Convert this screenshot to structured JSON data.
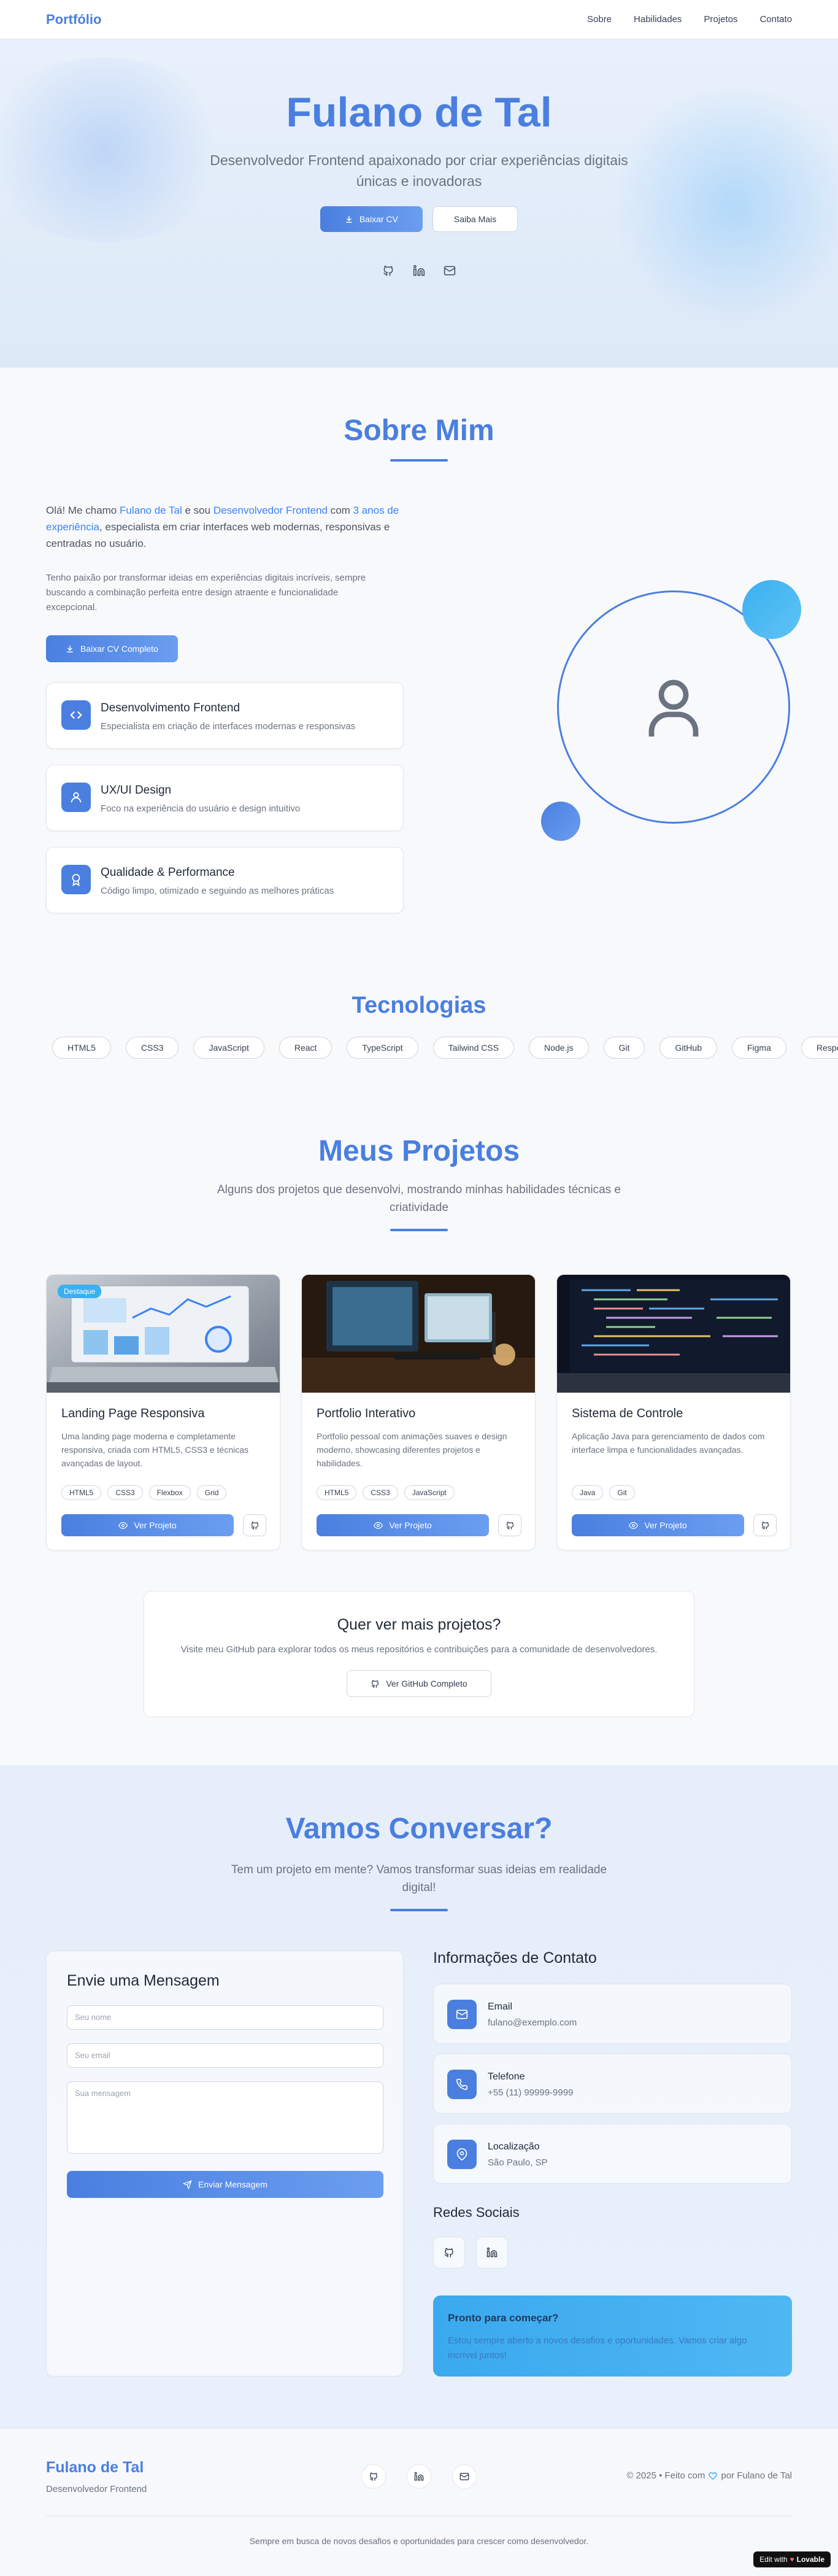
{
  "nav": {
    "brand": "Portfólio",
    "links": [
      "Sobre",
      "Habilidades",
      "Projetos",
      "Contato"
    ]
  },
  "hero": {
    "title": "Fulano de Tal",
    "subtitle": "Desenvolvedor Frontend apaixonado por criar experiências digitais únicas e inovadoras",
    "primary_button": "Baixar CV",
    "secondary_button": "Saiba Mais",
    "social_icons": [
      "github-icon",
      "linkedin-icon",
      "mail-icon"
    ]
  },
  "about": {
    "title": "Sobre Mim",
    "intro_prefix": "Olá! Me chamo ",
    "intro_name": "Fulano de Tal",
    "intro_mid": " e sou ",
    "intro_role": "Desenvolvedor Frontend",
    "intro_with": " com ",
    "intro_years": "3 anos de experiência",
    "intro_suffix": ", especialista em criar interfaces web modernas, responsivas e centradas no usuário.",
    "paragraph2": "Tenho paixão por transformar ideias em experiências digitais incríveis, sempre buscando a combinação perfeita entre design atraente e funcionalidade excepcional.",
    "cv_button": "Baixar CV Completo",
    "features": [
      {
        "icon": "code-icon",
        "title": "Desenvolvimento Frontend",
        "desc": "Especialista em criação de interfaces modernas e responsivas"
      },
      {
        "icon": "user-icon",
        "title": "UX/UI Design",
        "desc": "Foco na experiência do usuário e design intuitivo"
      },
      {
        "icon": "award-icon",
        "title": "Qualidade & Performance",
        "desc": "Código limpo, otimizado e seguindo as melhores práticas"
      }
    ],
    "avatar_icon": "user-icon"
  },
  "tech": {
    "title": "Tecnologias",
    "items": [
      "HTML5",
      "CSS3",
      "JavaScript",
      "React",
      "TypeScript",
      "Tailwind CSS",
      "Node.js",
      "Git",
      "GitHub",
      "Figma",
      "Responsive Design"
    ]
  },
  "projects": {
    "title": "Meus Projetos",
    "subtitle": "Alguns dos projetos que desenvolvi, mostrando minhas habilidades técnicas e criatividade",
    "view_label": "Ver Projeto",
    "items": [
      {
        "badge": "Destaque",
        "title": "Landing Page Responsiva",
        "desc": "Uma landing page moderna e completamente responsiva, criada com HTML5, CSS3 e técnicas avançadas de layout.",
        "tags": [
          "HTML5",
          "CSS3",
          "Flexbox",
          "Grid"
        ]
      },
      {
        "badge": "",
        "title": "Portfolio Interativo",
        "desc": "Portfolio pessoal com animações suaves e design moderno, showcasing diferentes projetos e habilidades.",
        "tags": [
          "HTML5",
          "CSS3",
          "JavaScript"
        ]
      },
      {
        "badge": "",
        "title": "Sistema de Controle",
        "desc": "Aplicação Java para gerenciamento de dados com interface limpa e funcionalidades avançadas.",
        "tags": [
          "Java",
          "Git"
        ]
      }
    ],
    "more_title": "Quer ver mais projetos?",
    "more_desc": "Visite meu GitHub para explorar todos os meus repositórios e contribuições para a comunidade de desenvolvedores.",
    "more_button": "Ver GitHub Completo"
  },
  "contact": {
    "title": "Vamos Conversar?",
    "subtitle": "Tem um projeto em mente? Vamos transformar suas ideias em realidade digital!",
    "form_title": "Envie uma Mensagem",
    "name_placeholder": "Seu nome",
    "email_placeholder": "Seu email",
    "message_placeholder": "Sua mensagem",
    "submit": "Enviar Mensagem",
    "info_title": "Informações de Contato",
    "info": [
      {
        "icon": "mail-icon",
        "label": "Email",
        "value": "fulano@exemplo.com"
      },
      {
        "icon": "phone-icon",
        "label": "Telefone",
        "value": "+55 (11) 99999-9999"
      },
      {
        "icon": "map-pin-icon",
        "label": "Localização",
        "value": "São Paulo, SP"
      }
    ],
    "social_title": "Redes Sociais",
    "ready_title": "Pronto para começar?",
    "ready_desc": "Estou sempre aberto a novos desafios e oportunidades. Vamos criar algo incrível juntos!"
  },
  "footer": {
    "brand": "Fulano de Tal",
    "role": "Desenvolvedor Frontend",
    "copy_prefix": "© 2025 • Feito com",
    "copy_suffix": "por Fulano de Tal",
    "tagline": "Sempre em busca de novos desafios e oportunidades para crescer como desenvolvedor.",
    "badge_prefix": "Edit with",
    "badge_brand": "Lovable"
  },
  "colors": {
    "accent": "#4a7fe0",
    "accent_light": "#3ab0f0"
  }
}
